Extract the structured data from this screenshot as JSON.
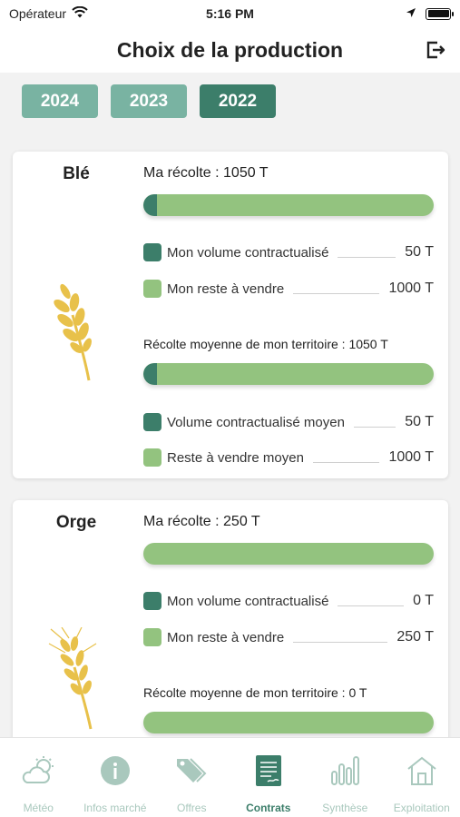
{
  "status": {
    "carrier": "Opérateur",
    "time": "5:16 PM"
  },
  "header": {
    "title": "Choix de la production",
    "logout_icon": "logout-icon"
  },
  "years": [
    {
      "label": "2024",
      "active": false
    },
    {
      "label": "2023",
      "active": false
    },
    {
      "label": "2022",
      "active": true
    }
  ],
  "colors": {
    "dark_green": "#3c7e6a",
    "light_green": "#93c37f",
    "tab_inactive": "#a9c8bd",
    "wheat": "#e8c14a"
  },
  "cards": [
    {
      "name": "Blé",
      "icon": "wheat-icon",
      "harvest_title": "Ma récolte : 1050 T",
      "harvest_contracted_fraction": 0.048,
      "my_contracted_label": "Mon volume contractualisé",
      "my_contracted_value": "50 T",
      "my_remaining_label": "Mon reste à vendre",
      "my_remaining_value": "1000 T",
      "territory_title": "Récolte moyenne de mon territoire : 1050 T",
      "territory_contracted_fraction": 0.048,
      "avg_contracted_label": "Volume contractualisé moyen",
      "avg_contracted_value": "50 T",
      "avg_remaining_label": "Reste à vendre moyen",
      "avg_remaining_value": "1000 T"
    },
    {
      "name": "Orge",
      "icon": "barley-icon",
      "harvest_title": "Ma récolte : 250 T",
      "harvest_contracted_fraction": 0,
      "my_contracted_label": "Mon volume contractualisé",
      "my_contracted_value": "0 T",
      "my_remaining_label": "Mon reste à vendre",
      "my_remaining_value": "250 T",
      "territory_title": "Récolte moyenne de mon territoire : 0 T",
      "territory_contracted_fraction": 0
    }
  ],
  "tabs": [
    {
      "label": "Météo",
      "icon": "weather-icon",
      "active": false
    },
    {
      "label": "Infos marché",
      "icon": "info-icon",
      "active": false
    },
    {
      "label": "Offres",
      "icon": "tags-icon",
      "active": false
    },
    {
      "label": "Contrats",
      "icon": "contract-icon",
      "active": true
    },
    {
      "label": "Synthèse",
      "icon": "chart-icon",
      "active": false
    },
    {
      "label": "Exploitation",
      "icon": "farm-icon",
      "active": false
    }
  ]
}
